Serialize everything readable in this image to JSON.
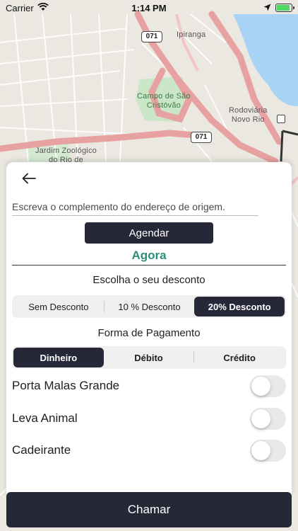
{
  "status_bar": {
    "carrier": "Carrier",
    "time": "1:14 PM",
    "wifi_icon": "wifi-icon",
    "location_icon": "location-arrow-icon",
    "battery_level": 0.9
  },
  "map": {
    "labels": {
      "ipiranga": "Ipiranga",
      "campo": "Campo de São\nCristóvão",
      "rodoviaria": "Rodoviária\nNovo Rio",
      "jardim": "Jardim Zoológico\ndo Rio de"
    },
    "shield_top": "071",
    "shield_bottom": "071",
    "colors": {
      "road": "#e8a1a1",
      "water": "#a9d3f5",
      "park": "#c9e6c7"
    }
  },
  "sheet": {
    "back_icon": "arrow-left-icon",
    "origin_placeholder": "Escreva o complemento do endereço de origem.",
    "schedule_label": "Agendar",
    "when_label": "Agora",
    "discount_title": "Escolha o seu desconto",
    "discounts": [
      "Sem Desconto",
      "10 % Desconto",
      "20% Desconto"
    ],
    "payment_title": "Forma de Pagamento",
    "payments": [
      "Dinheiro",
      "Débito",
      "Crédito"
    ],
    "toggles": [
      {
        "label": "Porta Malas Grande",
        "on": false
      },
      {
        "label": "Leva Animal",
        "on": false
      },
      {
        "label": "Cadeirante",
        "on": false
      }
    ]
  },
  "call_label": "Chamar",
  "colors": {
    "primary": "#262838",
    "accent": "#2a8f7a"
  }
}
